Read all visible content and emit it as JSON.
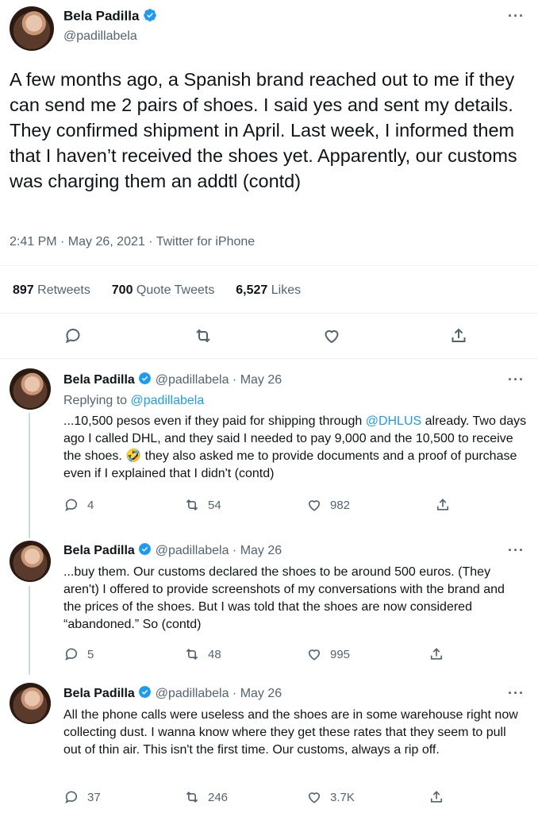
{
  "main_tweet": {
    "author_name": "Bela Padilla",
    "handle": "@padillabela",
    "text": "A few months ago, a Spanish brand reached out to me if they can send me 2 pairs of shoes. I said yes and sent my details. They confirmed shipment in April. Last week, I informed them that I haven’t received the shoes yet. Apparently, our customs was charging them an addtl (contd)",
    "timestamp": "2:41 PM · May 26, 2021 · ",
    "source": "Twitter for iPhone",
    "stats": {
      "retweets_count": "897",
      "retweets_label": "Retweets",
      "quotes_count": "700",
      "quotes_label": "Quote Tweets",
      "likes_count": "6,527",
      "likes_label": "Likes"
    },
    "more": "···"
  },
  "replies": [
    {
      "author_name": "Bela Padilla",
      "handle_date": "@padillabela · May 26",
      "replying_prefix": "Replying to ",
      "replying_to": "@padillabela",
      "text_before": "...10,500 pesos even if they paid for shipping through ",
      "mention": "@DHLUS",
      "text_after": " already. Two days ago I called DHL, and they said I needed to pay 9,000 and the 10,500 to receive the shoes. 🤣 they also asked me to provide documents and a proof of purchase even if I explained that I didn't (contd)",
      "replies": "4",
      "retweets": "54",
      "likes": "982",
      "more": "···"
    },
    {
      "author_name": "Bela Padilla",
      "handle_date": "@padillabela · May 26",
      "text": "...buy them. Our customs declared the shoes to be around 500 euros. (They aren't) I offered to provide screenshots of my conversations with the brand and the prices of the shoes. But I was told that the shoes are now considered “abandoned.” So (contd)",
      "replies": "5",
      "retweets": "48",
      "likes": "995",
      "more": "···"
    },
    {
      "author_name": "Bela Padilla",
      "handle_date": "@padillabela · May 26",
      "text": "All the phone calls were useless and the shoes are in some warehouse right now collecting dust. I wanna know where they get these rates that they seem to pull out of thin air. This isn't the first time. Our customs, always a rip off.",
      "replies": "37",
      "retweets": "246",
      "likes": "3.7K",
      "more": "···"
    }
  ],
  "icons": {
    "verified": "verified-badge-icon",
    "reply": "reply-icon",
    "retweet": "retweet-icon",
    "like": "heart-icon",
    "share": "share-icon",
    "more": "more-icon"
  },
  "colors": {
    "accent": "#1d9bf0",
    "text": "#0f1419",
    "muted": "#536471",
    "divider": "#eff3f4"
  }
}
